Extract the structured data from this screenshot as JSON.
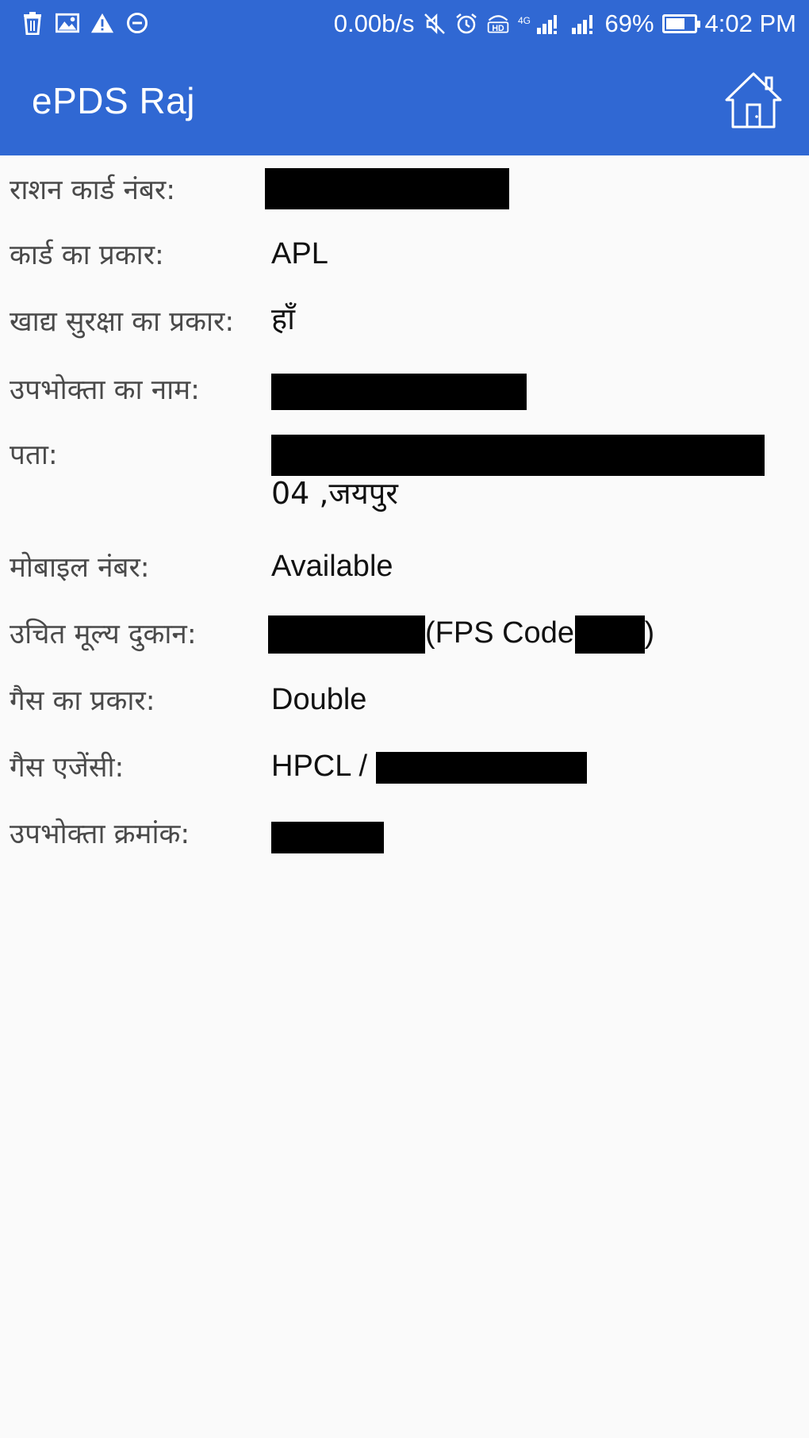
{
  "status_bar": {
    "network_speed": "0.00b/s",
    "network_type": "4G",
    "battery_percent": "69%",
    "battery_level": 0.69,
    "time": "4:02 PM",
    "left_icons": [
      "trash-icon",
      "image-icon",
      "warning-icon",
      "minus-circle-icon"
    ]
  },
  "app_bar": {
    "title": "ePDS Raj",
    "home_icon": "home-icon"
  },
  "details": {
    "ration_card": {
      "label": "राशन कार्ड नंबर:"
    },
    "card_type": {
      "label": "कार्ड का प्रकार:",
      "value": "APL"
    },
    "food_security": {
      "label": "खाद्य सुरक्षा का प्रकार:",
      "value": "हाँ"
    },
    "consumer_name": {
      "label": "उपभोक्ता का नाम:"
    },
    "address": {
      "label": "पता:",
      "value_line2": "04 ,जयपुर"
    },
    "mobile": {
      "label": "मोबाइल नंबर:",
      "value": "Available"
    },
    "fps": {
      "label": "उचित मूल्य दुकान:",
      "fps_prefix": "(FPS Code:",
      "fps_suffix": ")"
    },
    "gas_type": {
      "label": "गैस का प्रकार:",
      "value": "Double"
    },
    "gas_agency": {
      "label": "गैस एजेंसी:",
      "value_prefix": "HPCL / "
    },
    "consumer_number": {
      "label": "उपभोक्ता क्रमांक:"
    }
  },
  "colors": {
    "primary": "#3068d3",
    "background": "#fafafa",
    "label_text": "#4a4a4a",
    "value_text": "#111111"
  }
}
